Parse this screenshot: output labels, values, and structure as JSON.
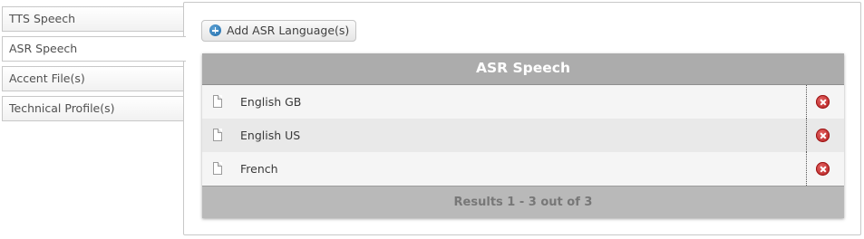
{
  "tabs": [
    {
      "label": "TTS Speech"
    },
    {
      "label": "ASR Speech"
    },
    {
      "label": "Accent File(s)"
    },
    {
      "label": "Technical Profile(s)"
    }
  ],
  "active_tab": "ASR Speech",
  "toolbar": {
    "add_label": "Add ASR Language(s)",
    "add_icon": "plus-circle-icon"
  },
  "grid": {
    "title": "ASR Speech",
    "rows": [
      {
        "name": "English GB"
      },
      {
        "name": "English US"
      },
      {
        "name": "French"
      }
    ],
    "footer": "Results 1 - 3 out of 3"
  },
  "colors": {
    "header_bg": "#acacac",
    "footer_bg": "#b9b9b9",
    "delete": "#c0282a",
    "add_icon": "#2a78b8"
  }
}
